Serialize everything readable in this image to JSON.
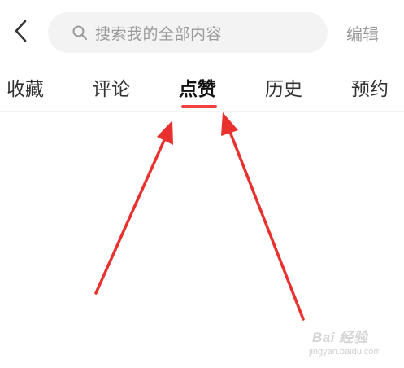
{
  "header": {
    "back_icon": "chevron-left-icon",
    "search": {
      "icon": "search-icon",
      "placeholder": "搜索我的全部内容"
    },
    "edit_label": "编辑"
  },
  "tabs": [
    {
      "label": "收藏",
      "active": false
    },
    {
      "label": "评论",
      "active": false
    },
    {
      "label": "点赞",
      "active": true
    },
    {
      "label": "历史",
      "active": false
    },
    {
      "label": "预约",
      "active": false
    }
  ],
  "colors": {
    "accent": "#f04142",
    "arrow": "#e8302e",
    "search_bg": "#f3f3f3",
    "muted_text": "#9a9a9a"
  },
  "watermark": {
    "brand": "Bai 经验",
    "url": "jingyan.baidu.com"
  }
}
